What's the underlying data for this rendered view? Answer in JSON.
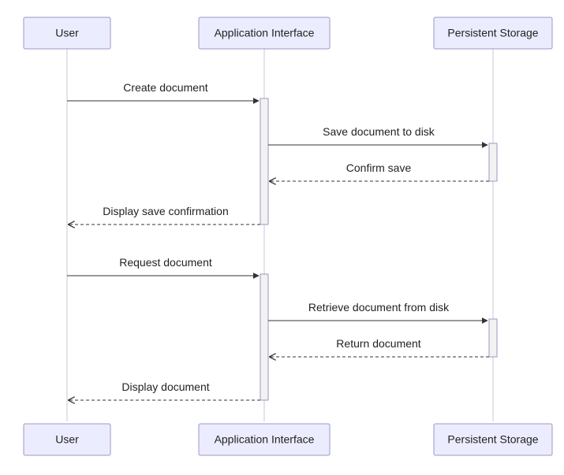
{
  "actors": {
    "user": "User",
    "app": "Application Interface",
    "storage": "Persistent Storage"
  },
  "messages": {
    "m1": "Create document",
    "m2": "Save document to disk",
    "m3": "Confirm save",
    "m4": "Display save confirmation",
    "m5": "Request document",
    "m6": "Retrieve document from disk",
    "m7": "Return document",
    "m8": "Display document"
  },
  "chart_data": {
    "type": "sequence-diagram",
    "title": "",
    "participants": [
      "User",
      "Application Interface",
      "Persistent Storage"
    ],
    "messages": [
      {
        "from": "User",
        "to": "Application Interface",
        "label": "Create document",
        "style": "solid"
      },
      {
        "from": "Application Interface",
        "to": "Persistent Storage",
        "label": "Save document to disk",
        "style": "solid"
      },
      {
        "from": "Persistent Storage",
        "to": "Application Interface",
        "label": "Confirm save",
        "style": "dashed"
      },
      {
        "from": "Application Interface",
        "to": "User",
        "label": "Display save confirmation",
        "style": "dashed"
      },
      {
        "from": "User",
        "to": "Application Interface",
        "label": "Request document",
        "style": "solid"
      },
      {
        "from": "Application Interface",
        "to": "Persistent Storage",
        "label": "Retrieve document from disk",
        "style": "solid"
      },
      {
        "from": "Persistent Storage",
        "to": "Application Interface",
        "label": "Return document",
        "style": "dashed"
      },
      {
        "from": "Application Interface",
        "to": "User",
        "label": "Display document",
        "style": "dashed"
      }
    ]
  }
}
